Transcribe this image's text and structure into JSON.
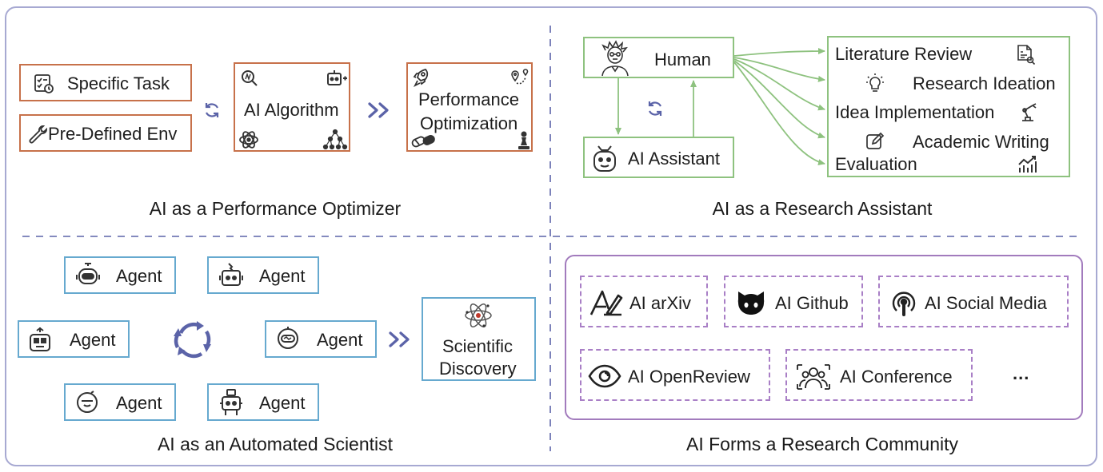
{
  "q1": {
    "task": "Specific Task",
    "env": "Pre-Defined Env",
    "algorithm": "AI Algorithm",
    "perf_line1": "Performance",
    "perf_line2": "Optimization",
    "caption": "AI as a Performance Optimizer"
  },
  "q2": {
    "human": "Human",
    "assistant": "AI Assistant",
    "tasks": [
      "Literature Review",
      "Research Ideation",
      "Idea Implementation",
      "Academic Writing",
      "Evaluation"
    ],
    "caption": "AI as a Research Assistant"
  },
  "q3": {
    "agent": "Agent",
    "sci_line1": "Scientific",
    "sci_line2": "Discovery",
    "caption": "AI as an Automated Scientist"
  },
  "q4": {
    "items": [
      "AI arXiv",
      "AI Github",
      "AI Social Media",
      "AI OpenReview",
      "AI Conference"
    ],
    "ellipsis": "...",
    "caption": "AI Forms a Research Community"
  },
  "colors": {
    "orange": "#c7714a",
    "green": "#8ec27f",
    "blue": "#66a9cf",
    "purple": "#a27bbd",
    "frame": "#a7a9d2",
    "navy": "#5b63a8"
  }
}
